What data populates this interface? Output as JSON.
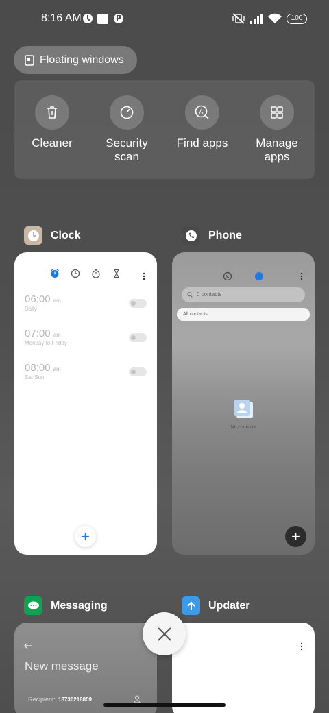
{
  "status_bar": {
    "time": "8:16 AM",
    "battery": "100",
    "icons": [
      "notification-icon",
      "square-icon",
      "notification-icon",
      "mute-vibrate-icon",
      "signal-icon",
      "wifi-icon",
      "battery-icon"
    ]
  },
  "floating_windows": {
    "label": "Floating windows",
    "icon": "floating-window-icon"
  },
  "quick_actions": [
    {
      "label": "Cleaner",
      "icon": "trash-icon"
    },
    {
      "label": "Security scan",
      "icon": "security-scan-icon"
    },
    {
      "label": "Find apps",
      "icon": "find-apps-icon"
    },
    {
      "label": "Manage apps",
      "icon": "grid-icon"
    }
  ],
  "apps": {
    "clock": {
      "name": "Clock",
      "alarms": [
        {
          "time": "06:00",
          "ampm": "am",
          "days": "Daily"
        },
        {
          "time": "07:00",
          "ampm": "am",
          "days": "Monday to Friday"
        },
        {
          "time": "08:00",
          "ampm": "am",
          "days": "Sat Sun"
        }
      ],
      "fab": "+"
    },
    "phone": {
      "name": "Phone",
      "search_placeholder": "0 contacts",
      "filter": "All contacts",
      "empty_text": "No contacts",
      "fab": "+"
    },
    "messaging": {
      "name": "Messaging",
      "title": "New message",
      "recipient_label": "Recipient:",
      "recipient_value": "18730218809"
    },
    "updater": {
      "name": "Updater"
    }
  },
  "colors": {
    "accent_blue": "#1f7ae0",
    "messaging_green": "#12a150",
    "updater_blue": "#3c9be8"
  }
}
